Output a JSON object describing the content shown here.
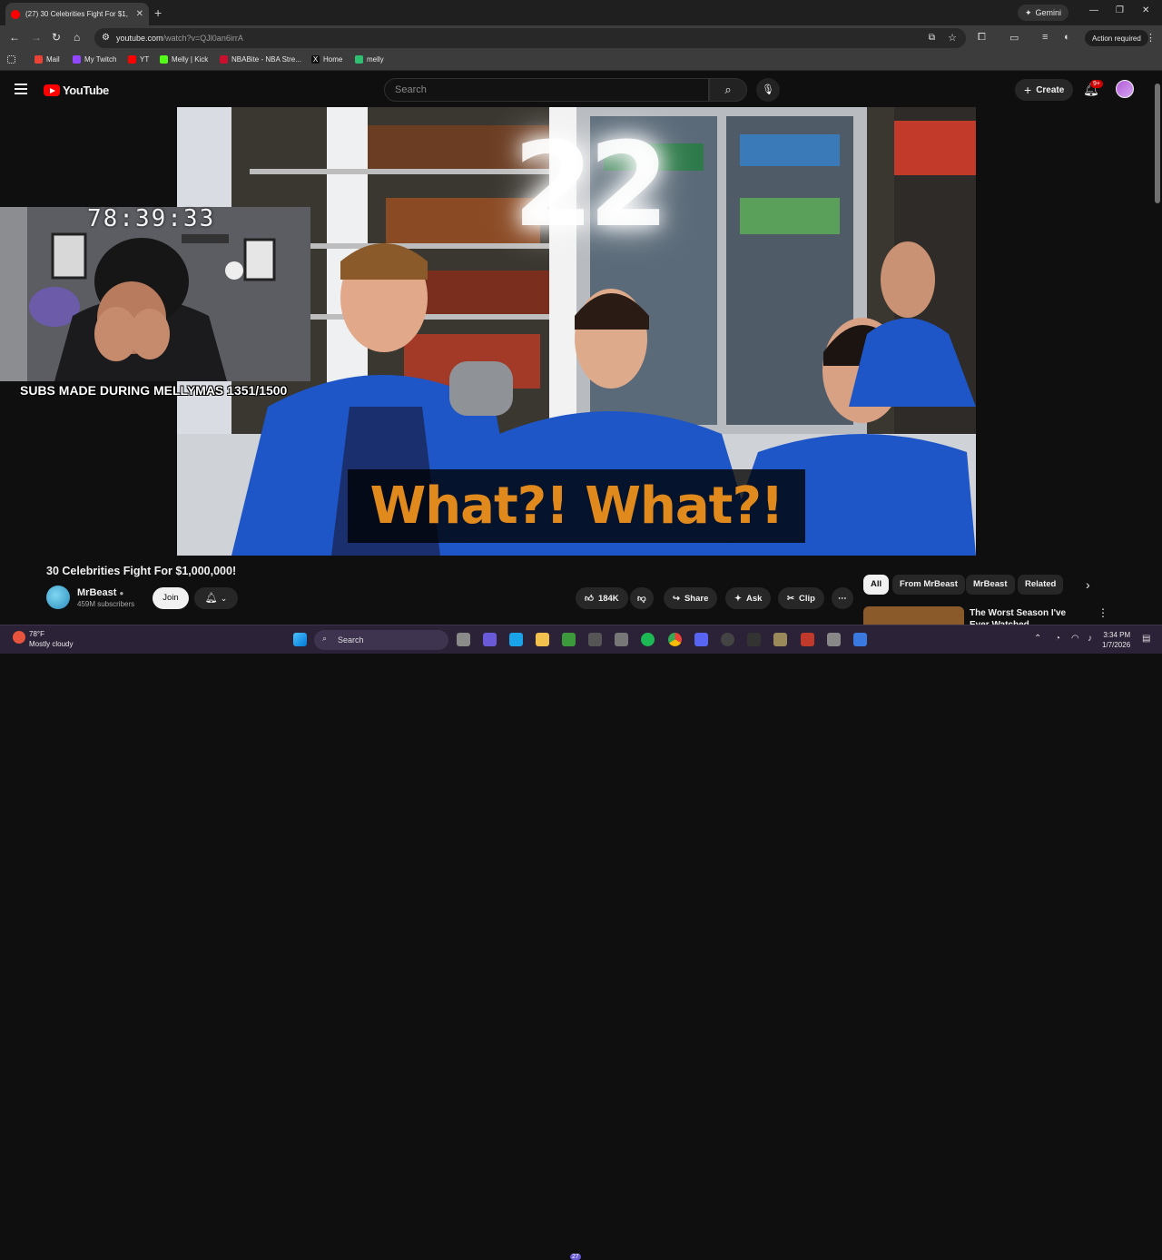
{
  "browser": {
    "tab_title": "(27) 30 Celebrities Fight For $1,000,000!",
    "tab_title_short": "(27) 30 Celebrities Fight For $1,",
    "new_tab": "+",
    "gemini_label": "Gemini",
    "url_host": "youtube.com",
    "url_path": "/watch?v=QJl0an6irrA",
    "action_required": "Action required",
    "bookmarks": [
      "Mail",
      "My Twitch",
      "YT",
      "Melly | Kick",
      "NBABite - NBA Stre...",
      "Home",
      "melly"
    ]
  },
  "youtube": {
    "logo_text": "YouTube",
    "search_placeholder": "Search",
    "create_label": "Create",
    "notification_badge": "9+"
  },
  "video": {
    "caption": "What?! What?!",
    "overlay_number": "22"
  },
  "stream_overlay": {
    "timer": "78:39:33",
    "subs_goal": "SUBS MADE DURING MELLYMAS 1351/1500"
  },
  "watch": {
    "title": "30 Celebrities Fight For $1,000,000!",
    "channel_name": "MrBeast",
    "channel_subs": "459M subscribers",
    "join_label": "Join",
    "likes": "184K",
    "share_label": "Share",
    "ask_label": "Ask",
    "clip_label": "Clip",
    "chips": [
      "All",
      "From MrBeast",
      "MrBeast",
      "Related"
    ],
    "next_video_title": "The Worst Season I've Ever Watched"
  },
  "taskbar": {
    "temperature": "78°F",
    "weather": "Mostly cloudy",
    "search_label": "Search",
    "time": "3:34 PM",
    "date": "1/7/2026",
    "badge_count": "27"
  },
  "colors": {
    "youtube_red": "#ff0000",
    "caption_orange": "#e08a1e",
    "jersey_blue": "#1e56c8"
  }
}
